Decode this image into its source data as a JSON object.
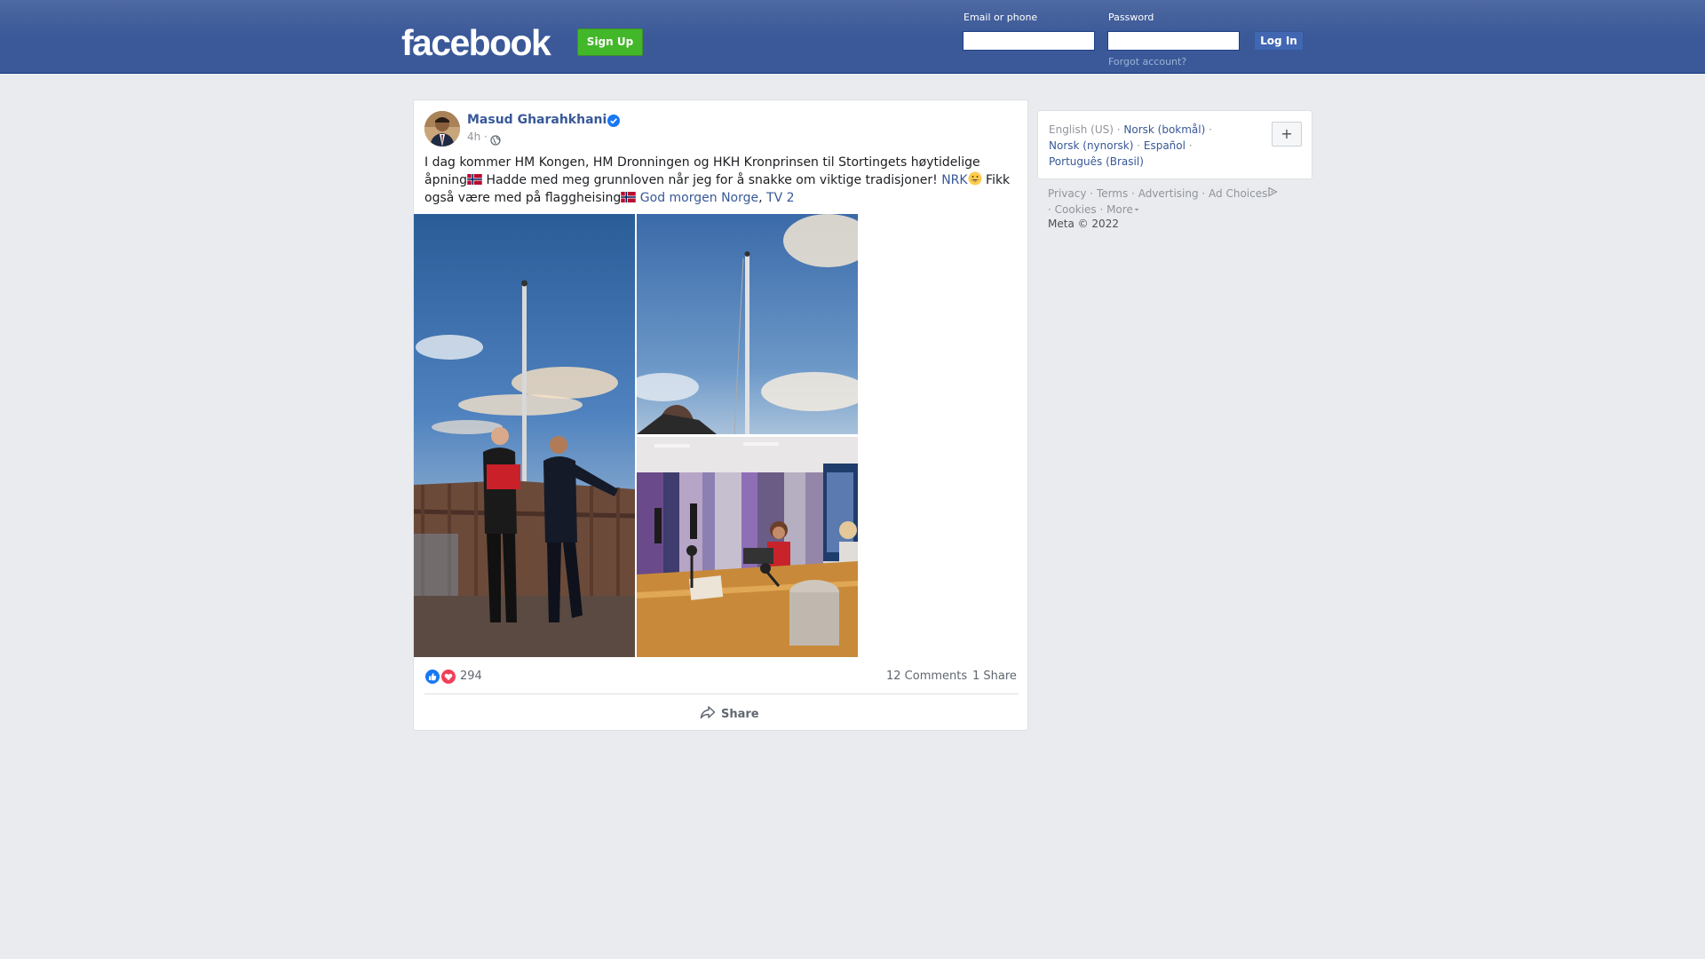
{
  "header": {
    "logo": "facebook",
    "signup_label": "Sign Up",
    "email_label": "Email or phone",
    "email_value": "",
    "password_label": "Password",
    "password_value": "",
    "login_label": "Log In",
    "forgot_label": "Forgot account?",
    "colors": {
      "bar": "#3b5998",
      "signup": "#42b72a",
      "login": "#4267b2"
    }
  },
  "post": {
    "author": "Masud Gharahkhani",
    "verified_icon": "verified-badge-icon",
    "time": "4h ·",
    "audience_icon": "globe-icon",
    "text_1": "I dag kommer HM Kongen, HM Dronningen og HKH Kronprinsen til Stortingets høytidelige åpning",
    "text_2": " Hadde med meg grunnloven når jeg for å snakke om viktige tradisjoner! ",
    "tag_nrk": "NRK",
    "text_3": " Fikk også være med på flaggheising",
    "tag_gmn": "God morgen Norge",
    "text_sep": ", ",
    "tag_tv2": "TV 2",
    "photos": [
      "flagpole-people-photo",
      "flagpole-sky-photo",
      "radio-studio-photo"
    ],
    "reaction_icons": [
      "like-icon",
      "love-icon"
    ],
    "reaction_count": "294",
    "comments": "12 Comments",
    "shares": "1 Share",
    "share_label": "Share"
  },
  "sidebar": {
    "languages": {
      "current": "English (US)",
      "options": [
        "Norsk (bokmål)",
        "Norsk (nynorsk)",
        "Español",
        "Português (Brasil)"
      ]
    },
    "lang_plus": "+",
    "footer": {
      "privacy": "Privacy",
      "terms": "Terms",
      "advertising": "Advertising",
      "ad_choices": "Ad Choices",
      "cookies": "Cookies",
      "more": "More"
    },
    "copyright": "Meta © 2022"
  }
}
